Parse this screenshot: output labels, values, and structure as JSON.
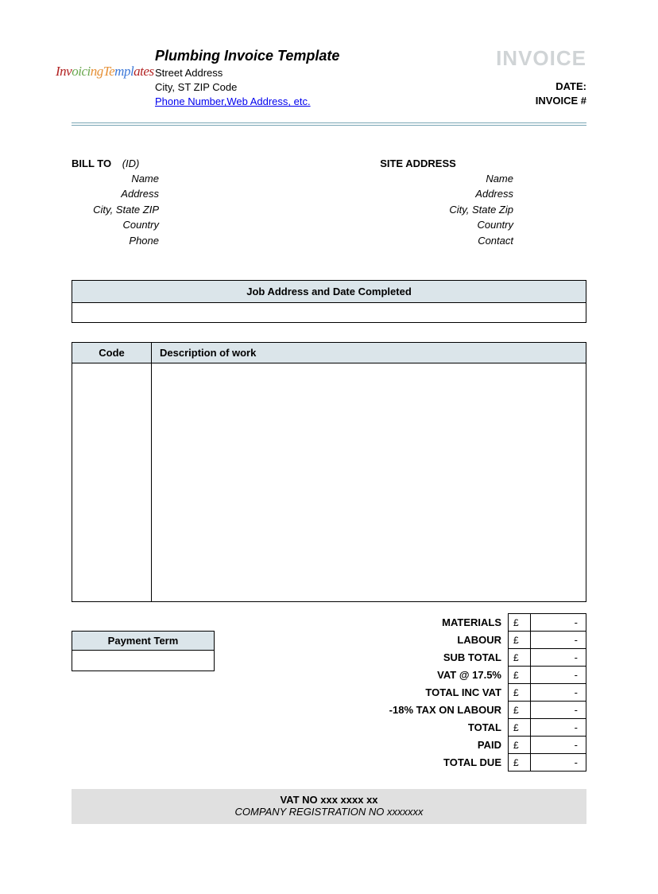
{
  "header": {
    "logo_text": "InvoicingTemplates",
    "title": "Plumbing Invoice Template",
    "street": "Street Address",
    "city": "City, ST  ZIP Code",
    "contact_link": "Phone Number,Web Address, etc.",
    "invoice_word": "INVOICE",
    "date_label": "DATE:",
    "invno_label": "INVOICE #"
  },
  "bill_to": {
    "head": "BILL TO",
    "id": "(ID)",
    "lines": [
      "Name",
      "Address",
      "City, State ZIP",
      "Country",
      "Phone"
    ]
  },
  "site": {
    "head": "SITE ADDRESS",
    "lines": [
      "Name",
      "Address",
      "City, State Zip",
      "Country",
      "Contact"
    ]
  },
  "job": {
    "head": "Job Address and Date Completed"
  },
  "work": {
    "col1": "Code",
    "col2": "Description of work"
  },
  "payment_term": {
    "head": "Payment Term"
  },
  "totals": {
    "currency": "£",
    "dash": "-",
    "rows": [
      "MATERIALS",
      "LABOUR",
      "SUB TOTAL",
      "VAT @ 17.5%",
      "TOTAL INC VAT",
      "-18% TAX ON LABOUR",
      "TOTAL",
      "PAID",
      "TOTAL DUE"
    ]
  },
  "footer": {
    "line1": "VAT NO  xxx xxxx xx",
    "line2": "COMPANY REGISTRATION NO xxxxxxx"
  }
}
